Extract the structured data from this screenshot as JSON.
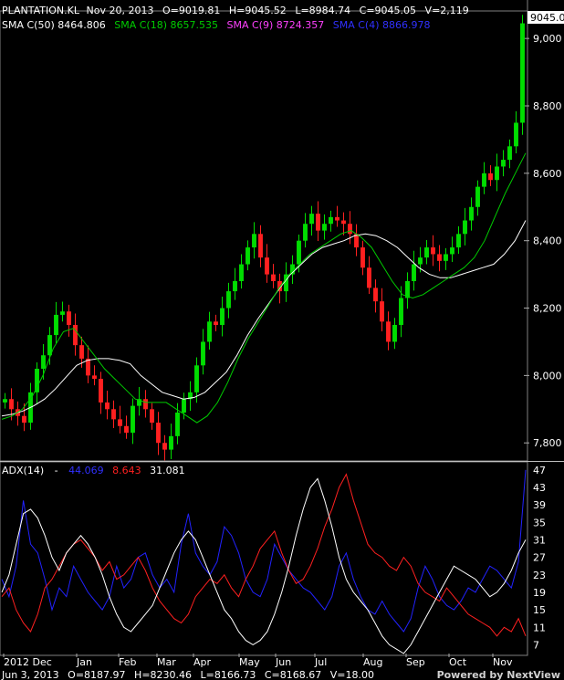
{
  "header": {
    "symbol": "PLANTATION.KL",
    "date": "Nov 20, 2013",
    "open": "O=9019.81",
    "high": "H=9045.52",
    "low": "L=8984.74",
    "close": "C=9045.05",
    "volume": "V=2,119",
    "sma50": "SMA C(50) 8464.806",
    "sma18": "SMA C(18) 8657.535",
    "sma9": "SMA C(9) 8724.357",
    "sma4": "SMA C(4) 8866.978",
    "last_price_badge": "9045.0"
  },
  "adx_header": {
    "name": "ADX(14)",
    "dash": "-",
    "plus_di": "44.069",
    "minus_di": "8.643",
    "adx": "31.081"
  },
  "footer": {
    "date": "Jun 3, 2013",
    "open": "O=8187.97",
    "high": "H=8230.46",
    "low": "L=8166.73",
    "close": "C=8168.67",
    "volume": "V=18.00",
    "brand": "Powered by NextView"
  },
  "colors": {
    "background": "#000000",
    "up_candle": "#00dd00",
    "down_candle": "#ff2020",
    "sma50": "#ffffff",
    "sma18": "#00cc00",
    "sma9": "#ff40ff",
    "sma4": "#3030ff",
    "plus_di": "#2222ff",
    "minus_di": "#ff2020",
    "adx": "#ffffff",
    "axis_text": "#ffffff"
  },
  "chart_data": [
    {
      "type": "candlestick",
      "x_labels": [
        "2012 Dec",
        "Jan",
        "Feb",
        "Mar",
        "Apr",
        "May",
        "Jun",
        "Jul",
        "Aug",
        "Sep",
        "Oct",
        "Nov"
      ],
      "y_ticks": [
        "7,800",
        "8,000",
        "8,200",
        "8,400",
        "8,600",
        "8,800",
        "9,000"
      ],
      "ylim": [
        7760,
        9060
      ],
      "close_series": [
        7930,
        7900,
        7880,
        7860,
        7950,
        8020,
        8060,
        8120,
        8180,
        8190,
        8150,
        8090,
        8050,
        8000,
        7990,
        7920,
        7900,
        7870,
        7850,
        7830,
        7910,
        7930,
        7900,
        7860,
        7800,
        7780,
        7820,
        7890,
        7930,
        7950,
        8030,
        8100,
        8160,
        8150,
        8200,
        8250,
        8280,
        8330,
        8380,
        8420,
        8350,
        8300,
        8280,
        8250,
        8300,
        8330,
        8400,
        8450,
        8480,
        8430,
        8450,
        8470,
        8460,
        8450,
        8420,
        8380,
        8320,
        8260,
        8220,
        8160,
        8100,
        8150,
        8230,
        8280,
        8330,
        8350,
        8380,
        8360,
        8340,
        8360,
        8380,
        8420,
        8460,
        8500,
        8560,
        8600,
        8580,
        8620,
        8640,
        8680,
        8750,
        9045
      ],
      "sma50_series": [
        7880,
        7885,
        7895,
        7910,
        7930,
        7960,
        7995,
        8030,
        8045,
        8050,
        8050,
        8045,
        8035,
        8000,
        7975,
        7950,
        7940,
        7930,
        7935,
        7950,
        7980,
        8010,
        8060,
        8120,
        8170,
        8215,
        8260,
        8300,
        8330,
        8360,
        8380,
        8390,
        8400,
        8415,
        8420,
        8415,
        8400,
        8380,
        8350,
        8320,
        8300,
        8290,
        8290,
        8300,
        8310,
        8320,
        8330,
        8360,
        8400,
        8460
      ],
      "sma18_series": [
        7870,
        7880,
        7900,
        7940,
        8000,
        8080,
        8130,
        8140,
        8100,
        8060,
        8020,
        7990,
        7960,
        7930,
        7920,
        7920,
        7920,
        7900,
        7880,
        7860,
        7880,
        7920,
        7980,
        8050,
        8110,
        8160,
        8210,
        8260,
        8300,
        8330,
        8360,
        8380,
        8400,
        8420,
        8430,
        8410,
        8380,
        8330,
        8280,
        8240,
        8230,
        8240,
        8260,
        8280,
        8300,
        8320,
        8350,
        8400,
        8470,
        8540,
        8600,
        8660
      ]
    },
    {
      "type": "line",
      "title": "ADX(14)",
      "y_ticks": [
        "7",
        "11",
        "15",
        "19",
        "23",
        "27",
        "31",
        "35",
        "39",
        "43",
        "47"
      ],
      "ylim": [
        5,
        48
      ],
      "series": [
        {
          "name": "+DI",
          "values": [
            22,
            18,
            25,
            40,
            30,
            28,
            22,
            15,
            20,
            18,
            25,
            22,
            19,
            17,
            15,
            18,
            25,
            20,
            22,
            27,
            28,
            23,
            20,
            22,
            19,
            30,
            37,
            28,
            25,
            23,
            26,
            34,
            32,
            28,
            22,
            19,
            18,
            22,
            30,
            27,
            24,
            22,
            20,
            19,
            17,
            15,
            18,
            25,
            28,
            22,
            18,
            15,
            14,
            17,
            14,
            12,
            10,
            13,
            20,
            25,
            22,
            18,
            16,
            15,
            17,
            20,
            19,
            22,
            25,
            24,
            22,
            20,
            26,
            47
          ]
        },
        {
          "name": "-DI",
          "values": [
            18,
            20,
            15,
            12,
            10,
            14,
            20,
            22,
            25,
            28,
            30,
            31,
            29,
            27,
            24,
            26,
            22,
            23,
            25,
            27,
            24,
            20,
            17,
            15,
            13,
            12,
            14,
            18,
            20,
            22,
            21,
            23,
            20,
            18,
            22,
            25,
            29,
            31,
            33,
            28,
            24,
            21,
            22,
            25,
            29,
            34,
            38,
            43,
            46,
            40,
            35,
            30,
            28,
            27,
            25,
            24,
            27,
            25,
            21,
            19,
            18,
            17,
            20,
            18,
            16,
            14,
            13,
            12,
            11,
            9,
            11,
            10,
            13,
            9
          ]
        },
        {
          "name": "ADX",
          "values": [
            19,
            23,
            30,
            37,
            38,
            36,
            32,
            27,
            24,
            28,
            30,
            32,
            30,
            27,
            23,
            18,
            14,
            11,
            10,
            12,
            14,
            16,
            20,
            24,
            28,
            31,
            33,
            31,
            27,
            23,
            19,
            15,
            13,
            10,
            8,
            7,
            8,
            10,
            14,
            19,
            25,
            32,
            38,
            43,
            45,
            40,
            34,
            27,
            22,
            19,
            17,
            15,
            12,
            9,
            7,
            6,
            5,
            7,
            10,
            13,
            16,
            19,
            22,
            25,
            24,
            23,
            22,
            20,
            18,
            19,
            21,
            24,
            28,
            31
          ]
        }
      ]
    }
  ]
}
